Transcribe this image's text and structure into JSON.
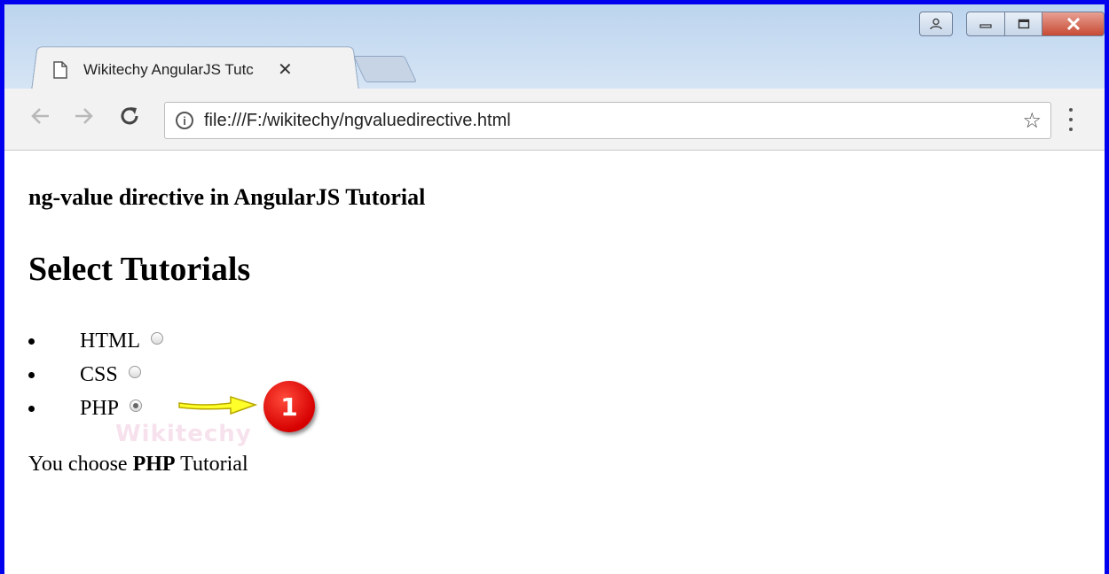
{
  "browser": {
    "tab_title": "Wikitechy AngularJS Tutc",
    "tab_close": "✕",
    "url": "file:///F:/wikitechy/ngvaluedirective.html",
    "info_glyph": "i"
  },
  "page": {
    "subtitle": "ng-value directive in AngularJS Tutorial",
    "title": "Select Tutorials",
    "options": [
      {
        "label": "HTML",
        "checked": false
      },
      {
        "label": "CSS",
        "checked": false
      },
      {
        "label": "PHP",
        "checked": true
      }
    ],
    "result_prefix": "You choose",
    "result_value": "PHP",
    "result_suffix": "Tutorial"
  },
  "annotation": {
    "marker_number": "1",
    "watermark": "Wikitechy"
  }
}
